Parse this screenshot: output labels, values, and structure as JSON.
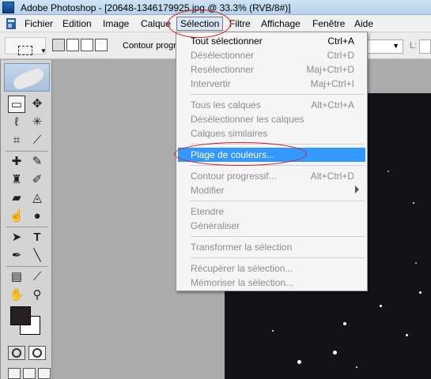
{
  "window": {
    "title": "Adobe Photoshop - [20648-1346179925.jpg @ 33.3% (RVB/8#)]"
  },
  "menubar": {
    "items": [
      "Fichier",
      "Edition",
      "Image",
      "Calque",
      "Sélection",
      "Filtre",
      "Affichage",
      "Fenêtre",
      "Aide"
    ]
  },
  "options": {
    "contour_label": "Contour progr",
    "l_label": "L:"
  },
  "selection_menu": {
    "items": [
      {
        "label": "Tout sélectionner",
        "shortcut": "Ctrl+A",
        "enabled": true
      },
      {
        "label": "Désélectionner",
        "shortcut": "Ctrl+D",
        "enabled": false
      },
      {
        "label": "Resélectionner",
        "shortcut": "Maj+Ctrl+D",
        "enabled": false
      },
      {
        "label": "Intervertir",
        "shortcut": "Maj+Ctrl+I",
        "enabled": false
      },
      {
        "label": "Tous les calques",
        "shortcut": "Alt+Ctrl+A",
        "enabled": false
      },
      {
        "label": "Désélectionner les calques",
        "shortcut": "",
        "enabled": false
      },
      {
        "label": "Calques similaires",
        "shortcut": "",
        "enabled": false
      },
      {
        "label": "Plage de couleurs...",
        "shortcut": "",
        "enabled": true,
        "highlighted": true
      },
      {
        "label": "Contour progressif...",
        "shortcut": "Alt+Ctrl+D",
        "enabled": false
      },
      {
        "label": "Modifier",
        "shortcut": "",
        "enabled": false,
        "submenu": true
      },
      {
        "label": "Etendre",
        "shortcut": "",
        "enabled": false
      },
      {
        "label": "Généraliser",
        "shortcut": "",
        "enabled": false
      },
      {
        "label": "Transformer la sélection",
        "shortcut": "",
        "enabled": false
      },
      {
        "label": "Récupérer la sélection...",
        "shortcut": "",
        "enabled": false
      },
      {
        "label": "Mémoriser la sélection...",
        "shortcut": "",
        "enabled": false
      }
    ]
  },
  "toolbox": {
    "type_tool_glyph": "T",
    "foreground_color": "#2a1f1f",
    "background_color": "#ffffff"
  },
  "annotations": {
    "color": "#d21d1d"
  },
  "colors": {
    "highlight": "#3399ff",
    "disabled_text": "#8d8d8d"
  }
}
